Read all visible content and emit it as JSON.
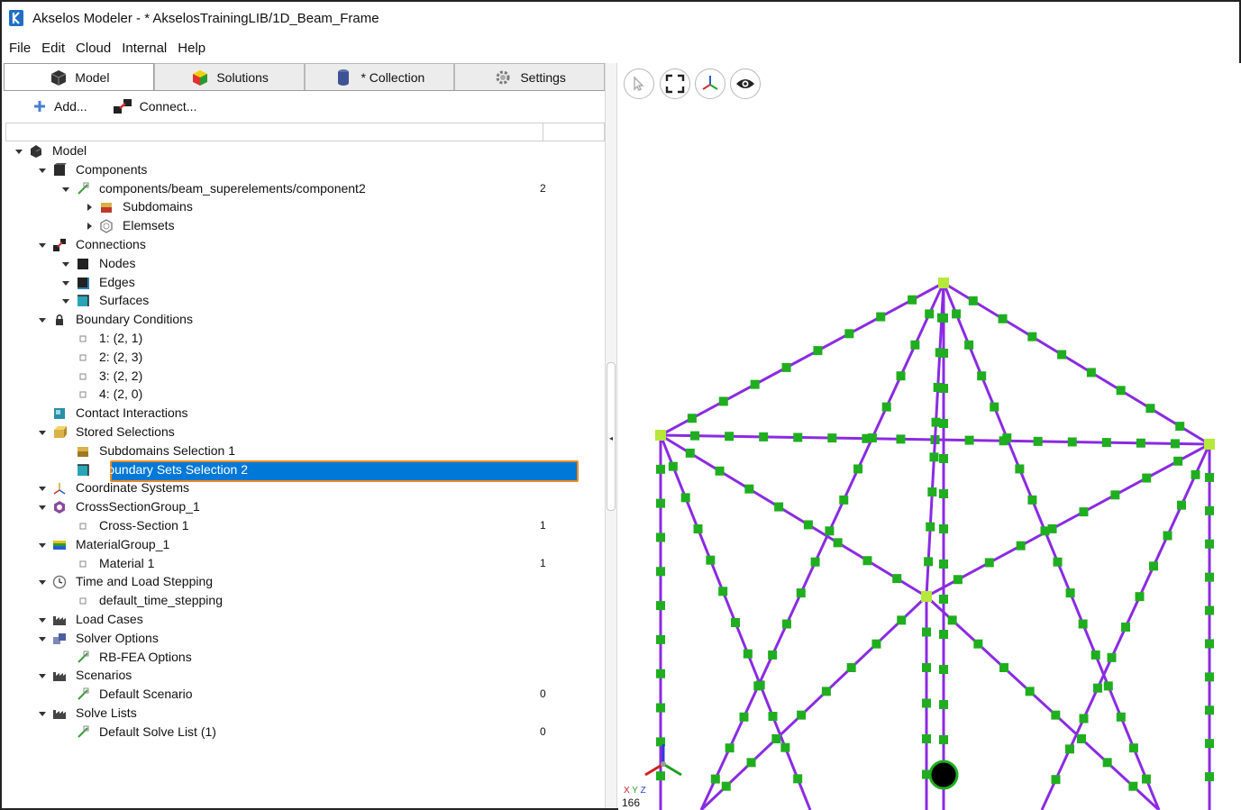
{
  "window": {
    "title": "Akselos Modeler - * AkselosTrainingLIB/1D_Beam_Frame"
  },
  "menu": [
    {
      "label": "File"
    },
    {
      "label": "Edit"
    },
    {
      "label": "Cloud"
    },
    {
      "label": "Internal"
    },
    {
      "label": "Help"
    }
  ],
  "tabs": [
    {
      "label": "Model",
      "icon": "cube-icon"
    },
    {
      "label": "Solutions",
      "icon": "colored-cube-icon"
    },
    {
      "label": "* Collection",
      "icon": "database-icon"
    },
    {
      "label": "Settings",
      "icon": "gear-icon"
    }
  ],
  "toolbar": {
    "add_label": "Add...",
    "connect_label": "Connect..."
  },
  "tree": [
    {
      "label": "Model",
      "level": 0,
      "arrow": "down",
      "icon": "model-icon"
    },
    {
      "label": "Components",
      "level": 1,
      "arrow": "down",
      "icon": "component-cube-icon"
    },
    {
      "label": "components/beam_superelements/component2",
      "level": 2,
      "arrow": "down",
      "icon": "edit-check-icon",
      "count": "2"
    },
    {
      "label": "Subdomains",
      "level": 3,
      "arrow": "right",
      "icon": "subdomain-icon"
    },
    {
      "label": "Elemsets",
      "level": 3,
      "arrow": "right",
      "icon": "hexagon-icon"
    },
    {
      "label": "Connections",
      "level": 1,
      "arrow": "down",
      "icon": "connections-icon"
    },
    {
      "label": "Nodes",
      "level": 2,
      "arrow": "down",
      "icon": "node-cube-icon"
    },
    {
      "label": "Edges",
      "level": 2,
      "arrow": "down",
      "icon": "edge-cube-icon"
    },
    {
      "label": "Surfaces",
      "level": 2,
      "arrow": "down",
      "icon": "surface-cube-icon"
    },
    {
      "label": "Boundary Conditions",
      "level": 1,
      "arrow": "down",
      "icon": "lock-icon"
    },
    {
      "label": "1: (2, 1)",
      "level": 2,
      "arrow": "none",
      "icon": "small-square-icon"
    },
    {
      "label": "2: (2, 3)",
      "level": 2,
      "arrow": "none",
      "icon": "small-square-icon"
    },
    {
      "label": "3: (2, 2)",
      "level": 2,
      "arrow": "none",
      "icon": "small-square-icon"
    },
    {
      "label": "4: (2, 0)",
      "level": 2,
      "arrow": "none",
      "icon": "small-square-icon"
    },
    {
      "label": "Contact Interactions",
      "level": 1,
      "arrow": "none",
      "icon": "contact-icon"
    },
    {
      "label": "Stored Selections",
      "level": 1,
      "arrow": "down",
      "icon": "stored-selection-icon"
    },
    {
      "label": "Subdomains Selection 1",
      "level": 2,
      "arrow": "none",
      "icon": "subdomain-selection-icon"
    },
    {
      "label": "Boundary Sets Selection 2",
      "level": 2,
      "arrow": "none",
      "icon": "boundary-selection-icon",
      "selected": true
    },
    {
      "label": "Coordinate Systems",
      "level": 1,
      "arrow": "down",
      "icon": "axes-icon"
    },
    {
      "label": "CrossSectionGroup_1",
      "level": 1,
      "arrow": "down",
      "icon": "cross-section-icon"
    },
    {
      "label": "Cross-Section 1",
      "level": 2,
      "arrow": "none",
      "icon": "small-square-icon",
      "count": "1"
    },
    {
      "label": "MaterialGroup_1",
      "level": 1,
      "arrow": "down",
      "icon": "material-icon"
    },
    {
      "label": "Material 1",
      "level": 2,
      "arrow": "none",
      "icon": "small-square-icon",
      "count": "1"
    },
    {
      "label": "Time and Load Stepping",
      "level": 1,
      "arrow": "down",
      "icon": "clock-icon"
    },
    {
      "label": "default_time_stepping",
      "level": 2,
      "arrow": "none",
      "icon": "small-square-icon"
    },
    {
      "label": "Load Cases",
      "level": 1,
      "arrow": "down",
      "icon": "factory-icon"
    },
    {
      "label": "Solver Options",
      "level": 1,
      "arrow": "down",
      "icon": "solver-icon"
    },
    {
      "label": "RB-FEA Options",
      "level": 2,
      "arrow": "none",
      "icon": "edit-check-icon"
    },
    {
      "label": "Scenarios",
      "level": 1,
      "arrow": "down",
      "icon": "factory-icon"
    },
    {
      "label": "Default Scenario",
      "level": 2,
      "arrow": "none",
      "icon": "edit-check-icon",
      "count": "0"
    },
    {
      "label": "Solve Lists",
      "level": 1,
      "arrow": "down",
      "icon": "factory-icon"
    },
    {
      "label": "Default Solve List (1)",
      "level": 2,
      "arrow": "none",
      "icon": "edit-check-icon",
      "count": "0"
    }
  ],
  "viewport": {
    "buttons": [
      {
        "icon": "pointer-icon"
      },
      {
        "icon": "fit-view-icon"
      },
      {
        "icon": "axes-view-icon"
      },
      {
        "icon": "eye-icon"
      }
    ],
    "axis_label": "X Y Z",
    "coord_readout": "166",
    "colors": {
      "beam": "#8a2be2",
      "node": "#1fae1f",
      "corner_node": "#b5e83a"
    }
  }
}
